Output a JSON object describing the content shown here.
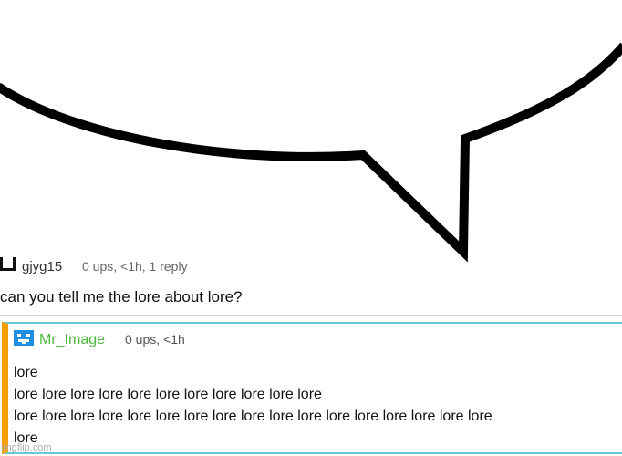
{
  "comment": {
    "username": "gjyg15",
    "meta": "0 ups, <1h, 1 reply",
    "text": "can you tell me the lore about lore?"
  },
  "reply": {
    "username": "Mr_Image",
    "meta": "0 ups, <1h",
    "lines": [
      "lore",
      "lore lore lore lore lore lore lore lore lore lore lore",
      "lore lore lore lore lore lore lore lore lore lore lore lore lore lore lore lore lore",
      "lore"
    ]
  },
  "watermark": "imgflip.com",
  "colors": {
    "reply_accent": "#f5a000",
    "reply_border": "#66c7d6",
    "reply_username": "#4db83d",
    "avatar_blue": "#1e8fe0"
  },
  "icons": {
    "top_avatar": "empty-square-icon",
    "reply_avatar": "pixel-face-icon"
  }
}
